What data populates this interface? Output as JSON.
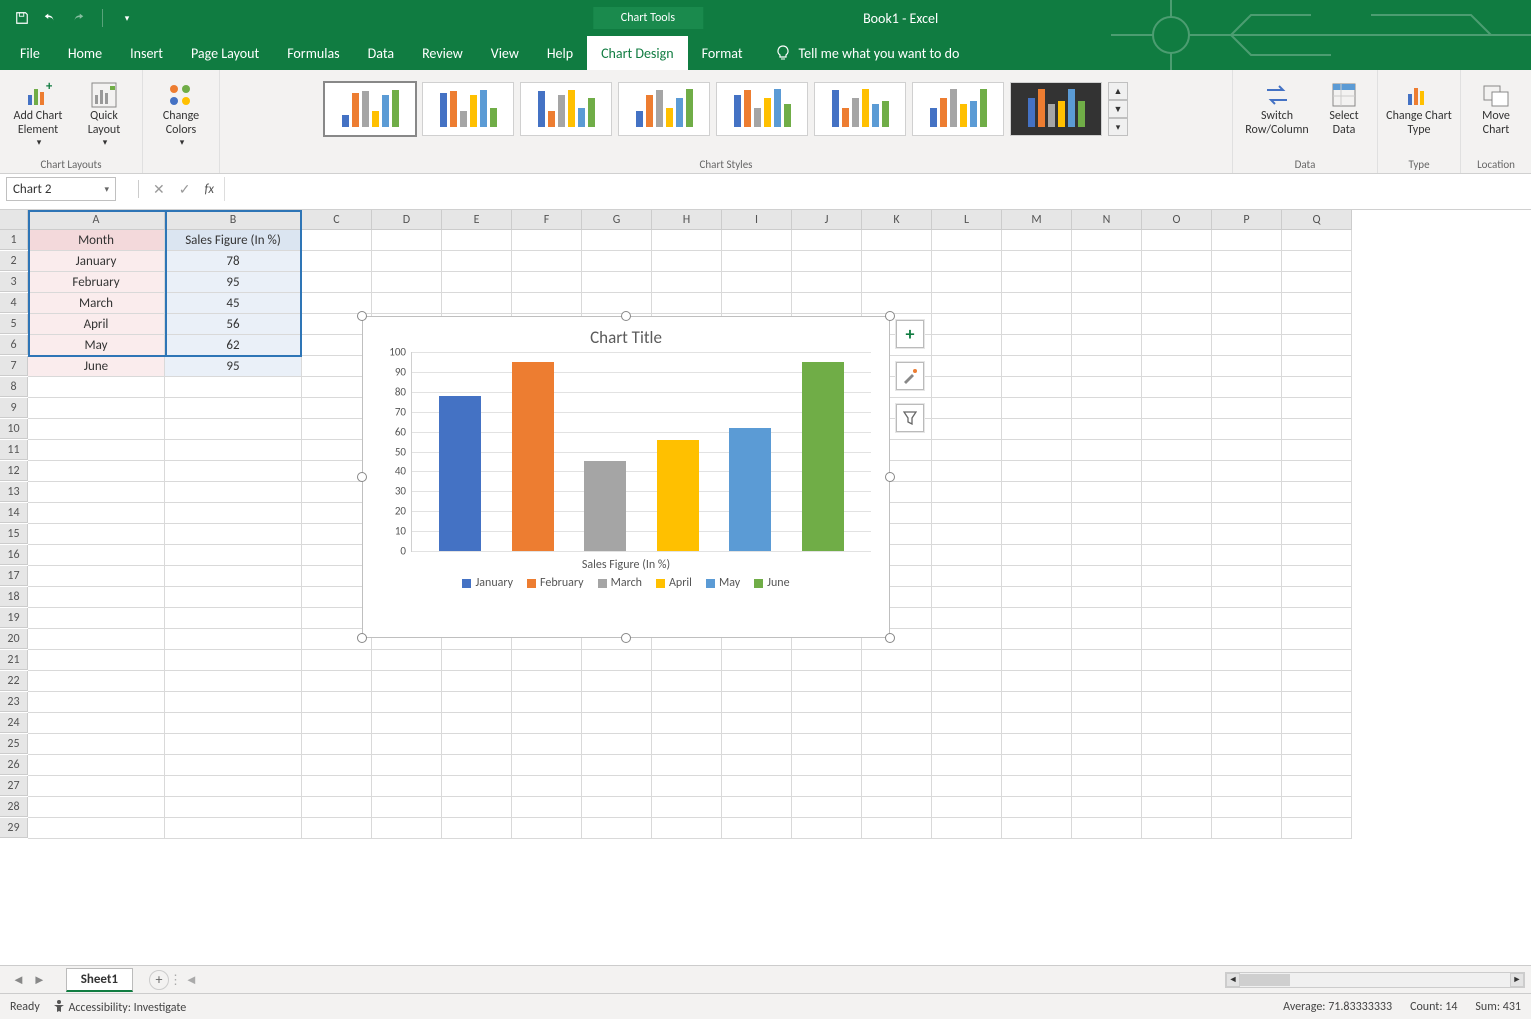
{
  "titlebar": {
    "chart_tools_label": "Chart Tools",
    "document_title": "Book1  -  Excel"
  },
  "menu": {
    "file": "File",
    "home": "Home",
    "insert": "Insert",
    "page_layout": "Page Layout",
    "formulas": "Formulas",
    "data": "Data",
    "review": "Review",
    "view": "View",
    "help": "Help",
    "chart_design": "Chart Design",
    "format": "Format",
    "tellme": "Tell me what you want to do"
  },
  "ribbon": {
    "chart_layouts": {
      "add_element": "Add Chart Element",
      "quick_layout": "Quick Layout",
      "group": "Chart Layouts"
    },
    "change_colors": "Change Colors",
    "chart_styles_group": "Chart Styles",
    "data_group": {
      "switch": "Switch Row/Column",
      "select": "Select Data",
      "group": "Data"
    },
    "type_group": {
      "change": "Change Chart Type",
      "group": "Type"
    },
    "location_group": {
      "move": "Move Chart",
      "group": "Location"
    }
  },
  "namebox": "Chart 2",
  "columns": [
    "A",
    "B",
    "C",
    "D",
    "E",
    "F",
    "G",
    "H",
    "I",
    "J",
    "K",
    "L",
    "M",
    "N",
    "O",
    "P",
    "Q"
  ],
  "row_count": 29,
  "table": {
    "headers": [
      "Month",
      "Sales Figure (In %)"
    ],
    "rows": [
      [
        "January",
        "78"
      ],
      [
        "February",
        "95"
      ],
      [
        "March",
        "45"
      ],
      [
        "April",
        "56"
      ],
      [
        "May",
        "62"
      ],
      [
        "June",
        "95"
      ]
    ]
  },
  "chart_data": {
    "type": "bar",
    "title": "Chart Title",
    "categories": [
      "January",
      "February",
      "March",
      "April",
      "May",
      "June"
    ],
    "values": [
      78,
      95,
      45,
      56,
      62,
      95
    ],
    "colors": [
      "#4472C4",
      "#ED7D31",
      "#A5A5A5",
      "#FFC000",
      "#5B9BD5",
      "#70AD47"
    ],
    "axis_title": "Sales Figure (In %)",
    "ylim": [
      0,
      100
    ],
    "ystep": 10,
    "legend": [
      "January",
      "February",
      "March",
      "April",
      "May",
      "June"
    ]
  },
  "sheet_tab": "Sheet1",
  "status": {
    "ready": "Ready",
    "accessibility": "Accessibility: Investigate",
    "average": "Average: 71.83333333",
    "count": "Count: 14",
    "sum": "Sum: 431"
  }
}
